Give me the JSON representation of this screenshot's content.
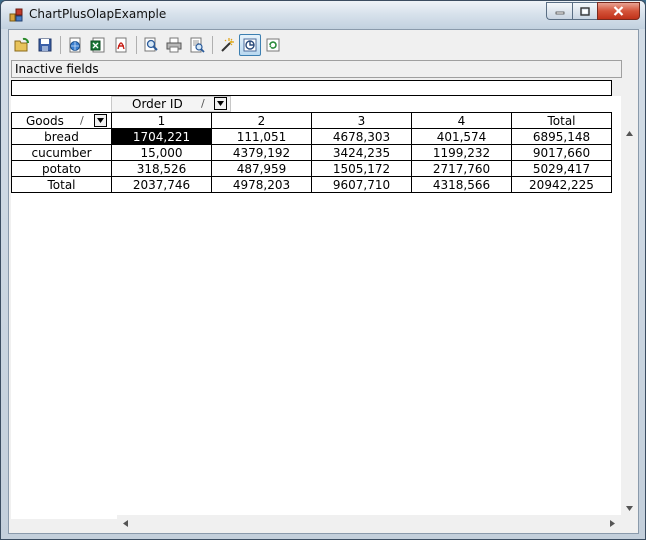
{
  "window": {
    "title": "ChartPlusOlapExample"
  },
  "toolbar": {
    "buttons": [
      "open-icon",
      "save-icon",
      "export-html-icon",
      "export-excel-icon",
      "export-pdf-icon",
      "zoom-icon",
      "print-icon",
      "print-preview-icon",
      "wizard-icon",
      "chart-toggle-icon",
      "refresh-icon"
    ]
  },
  "inactive_fields": {
    "label": "Inactive fields"
  },
  "pivot": {
    "column_field": {
      "label": "Order ID",
      "sort": "/"
    },
    "row_field": {
      "label": "Goods",
      "sort": "/"
    },
    "columns": [
      "1",
      "2",
      "3",
      "4",
      "Total"
    ],
    "rows": [
      {
        "label": "bread",
        "values": [
          "1704,221",
          "111,051",
          "4678,303",
          "401,574",
          "6895,148"
        ]
      },
      {
        "label": "cucumber",
        "values": [
          "15,000",
          "4379,192",
          "3424,235",
          "1199,232",
          "9017,660"
        ]
      },
      {
        "label": "potato",
        "values": [
          "318,526",
          "487,959",
          "1505,172",
          "2717,760",
          "5029,417"
        ]
      },
      {
        "label": "Total",
        "values": [
          "2037,746",
          "4978,203",
          "9607,710",
          "4318,566",
          "20942,225"
        ]
      }
    ],
    "selected_cell": {
      "row": 0,
      "col": 0
    }
  }
}
